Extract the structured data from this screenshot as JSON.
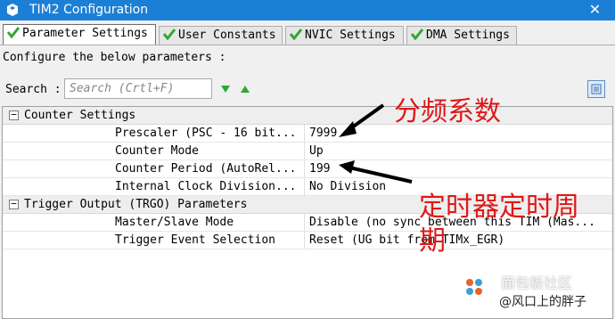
{
  "window": {
    "title": "TIM2 Configuration",
    "close_glyph": "✕"
  },
  "tabs": [
    {
      "label": "Parameter Settings",
      "active": true
    },
    {
      "label": "User Constants",
      "active": false
    },
    {
      "label": "NVIC Settings",
      "active": false
    },
    {
      "label": "DMA Settings",
      "active": false
    }
  ],
  "header": {
    "configure_text": "Configure the below parameters :"
  },
  "search": {
    "label": "Search :",
    "placeholder": "Search (Crtl+F)"
  },
  "groups": [
    {
      "label": "Counter Settings",
      "expander": "−",
      "rows": [
        {
          "name": "Prescaler (PSC - 16 bit...",
          "value": "7999"
        },
        {
          "name": "Counter Mode",
          "value": "Up"
        },
        {
          "name": "Counter Period (AutoRel...",
          "value": "199"
        },
        {
          "name": "Internal Clock Division...",
          "value": "No Division"
        }
      ]
    },
    {
      "label": "Trigger Output (TRGO) Parameters",
      "expander": "−",
      "rows": [
        {
          "name": "Master/Slave Mode",
          "value": "Disable (no sync between this TIM (Mas..."
        },
        {
          "name": "Trigger Event Selection",
          "value": "Reset (UG bit from TIMx_EGR)"
        }
      ]
    }
  ],
  "annotations": {
    "prescaler_note": "分频系数",
    "period_note": "定时器定时周期",
    "color": "#e01818"
  },
  "watermark": {
    "line1": "面包板社区",
    "line2": "@风口上的胖子"
  },
  "colors": {
    "titlebar": "#1c7fd6",
    "check": "#2fa82f"
  },
  "icons": {
    "app": "stm32-cube-icon",
    "tab_check": "check-icon",
    "search_down": "arrow-down-icon",
    "search_up": "arrow-up-icon",
    "view": "list-view-icon"
  }
}
